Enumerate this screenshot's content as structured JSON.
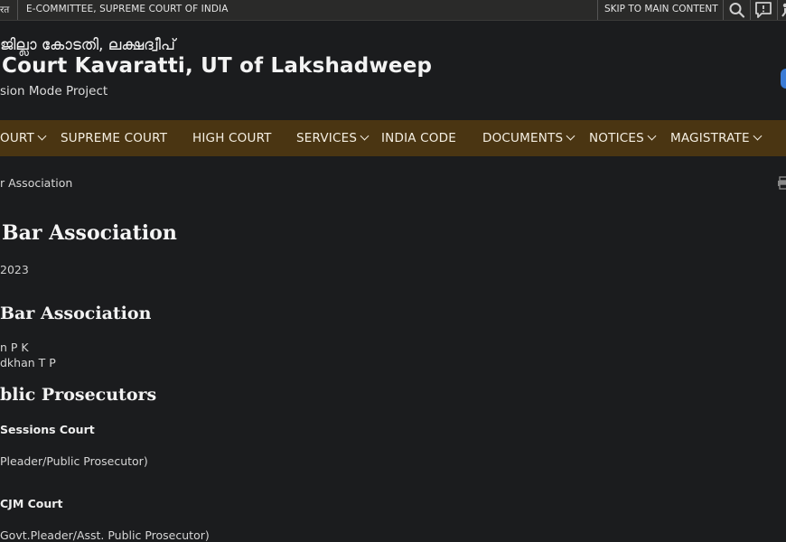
{
  "topbar": {
    "gov_text": "रत",
    "ecommittee": "E-COMMITTEE, SUPREME COURT OF INDIA",
    "skip": "SKIP TO MAIN CONTENT",
    "icons": [
      "search-icon",
      "feedback-icon",
      "accessibility-icon"
    ]
  },
  "header": {
    "malayalam": "ജില്ലാ കോടതി, ലക്ഷദ്വീപ്",
    "court_name": "Court Kavaratti, UT of Lakshadweep",
    "mission": "sion Mode Project"
  },
  "nav": [
    {
      "label": "OURT",
      "dropdown": true
    },
    {
      "label": "SUPREME COURT",
      "dropdown": false
    },
    {
      "label": "HIGH COURT",
      "dropdown": false
    },
    {
      "label": "SERVICES",
      "dropdown": true
    },
    {
      "label": "INDIA CODE",
      "dropdown": false
    },
    {
      "label": "DOCUMENTS",
      "dropdown": true
    },
    {
      "label": "NOTICES",
      "dropdown": true
    },
    {
      "label": "MAGISTRATE",
      "dropdown": true
    }
  ],
  "breadcrumb": "r Association",
  "page": {
    "title": "Bar Association",
    "date": "2023",
    "section1_title": "Bar Association",
    "section1_lines": [
      "n P K",
      "dkhan T P"
    ],
    "section2_title": "blic Prosecutors",
    "sub1_title": "Sessions Court",
    "sub1_text": "Pleader/Public Prosecutor)",
    "sub2_title": "CJM Court",
    "sub2_text": "Govt.Pleader/Asst. Public Prosecutor)"
  },
  "colors": {
    "background": "#1b1c1e",
    "topbar": "#2a2a29",
    "nav": "#4a3512",
    "text": "#e8e8e8"
  }
}
